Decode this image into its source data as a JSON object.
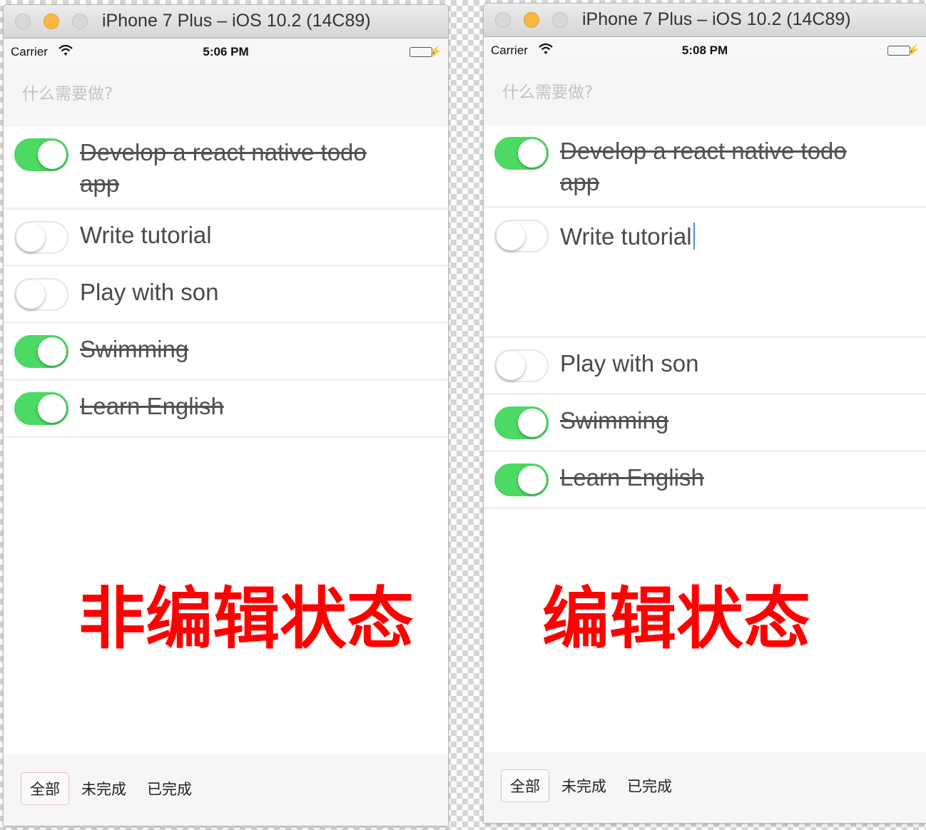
{
  "window_title": "iPhone 7 Plus – iOS 10.2 (14C89)",
  "carrier": "Carrier",
  "placeholder": "什么需要做?",
  "accent_color": "#4cd964",
  "overlay_color": "#ff0000",
  "left": {
    "time": "5:06 PM",
    "overlay": "非编辑状态",
    "todos": [
      {
        "text": "Develop a react native todo app",
        "completed": true
      },
      {
        "text": "Write tutorial",
        "completed": false
      },
      {
        "text": "Play with son",
        "completed": false
      },
      {
        "text": "Swimming",
        "completed": true
      },
      {
        "text": "Learn English",
        "completed": true
      }
    ]
  },
  "right": {
    "time": "5:08 PM",
    "overlay": "编辑状态",
    "editing_item": "Write tutorial",
    "todos": [
      {
        "text": "Develop a react native todo app",
        "completed": true
      },
      {
        "text": "Write tutorial",
        "completed": false
      },
      {
        "text": "Play with son",
        "completed": false
      },
      {
        "text": "Swimming",
        "completed": true
      },
      {
        "text": "Learn English",
        "completed": true
      }
    ]
  },
  "filters": {
    "all": "全部",
    "active": "未完成",
    "completed": "已完成",
    "selected": "全部"
  }
}
